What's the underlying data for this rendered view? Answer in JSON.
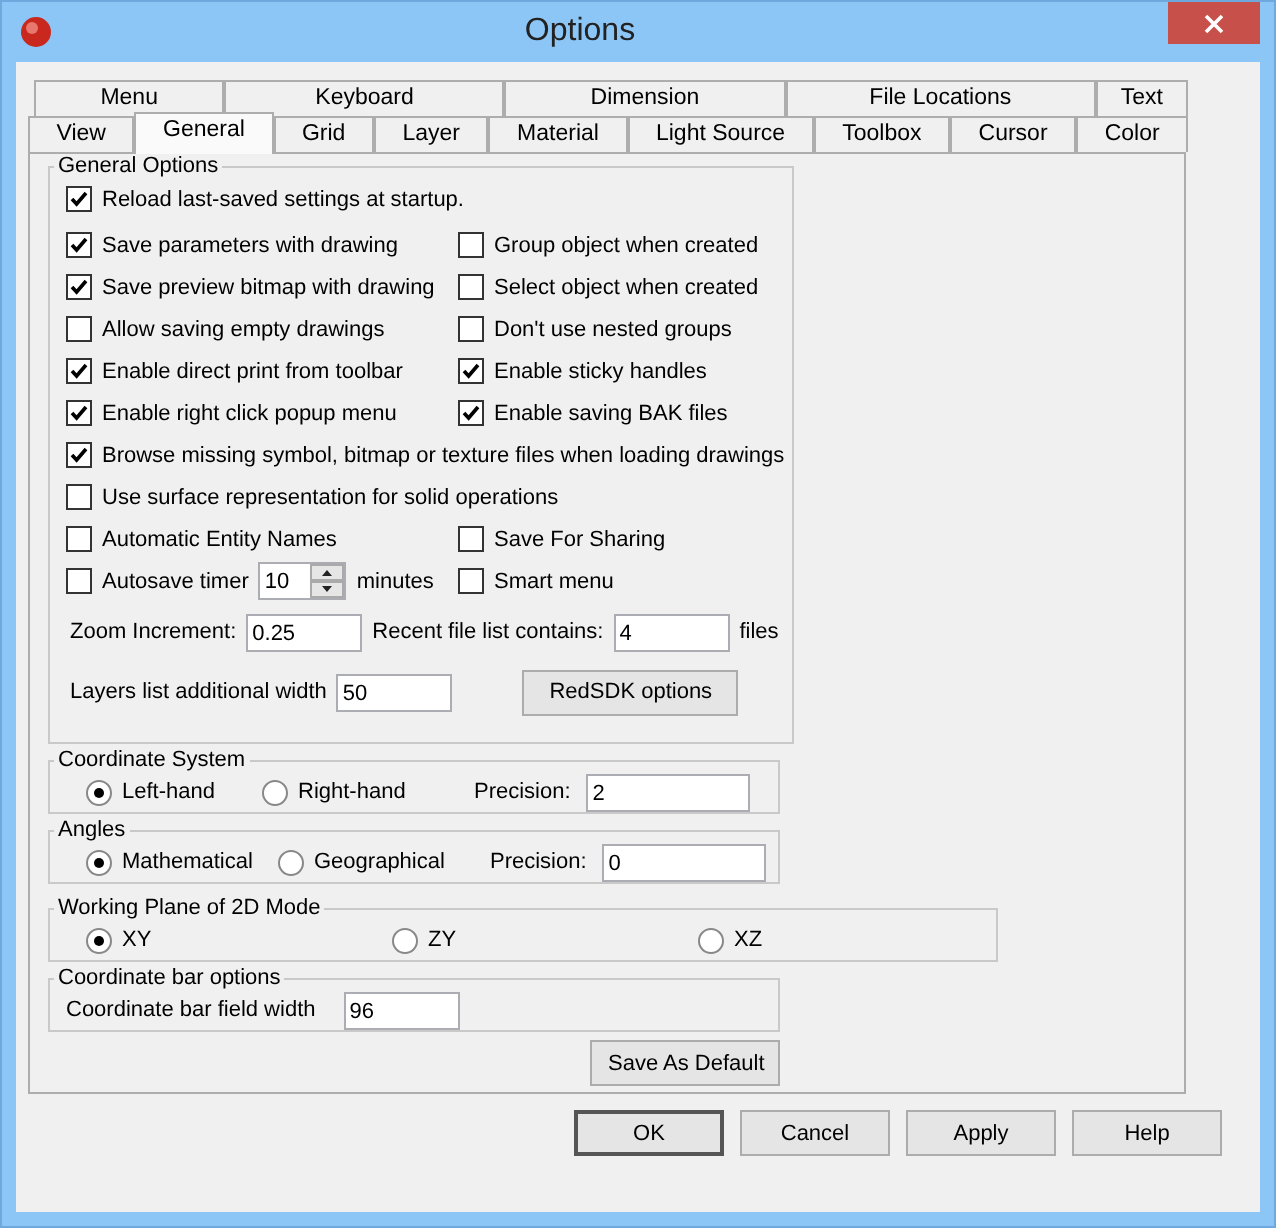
{
  "window": {
    "title": "Options"
  },
  "tab_rows": [
    [
      {
        "label": "Menu",
        "selected": false
      },
      {
        "label": "Keyboard",
        "selected": false
      },
      {
        "label": "Dimension",
        "selected": false
      },
      {
        "label": "File Locations",
        "selected": false
      },
      {
        "label": "Text",
        "selected": false
      }
    ],
    [
      {
        "label": "View",
        "selected": false
      },
      {
        "label": "General",
        "selected": true
      },
      {
        "label": "Grid",
        "selected": false
      },
      {
        "label": "Layer",
        "selected": false
      },
      {
        "label": "Material",
        "selected": false
      },
      {
        "label": "Light Source",
        "selected": false
      },
      {
        "label": "Toolbox",
        "selected": false
      },
      {
        "label": "Cursor",
        "selected": false
      },
      {
        "label": "Color",
        "selected": false
      }
    ]
  ],
  "general_options": {
    "title": "General Options",
    "rows": [
      {
        "left": [
          {
            "kind": "checkbox",
            "label": "Reload last-saved settings at startup.",
            "checked": true
          }
        ]
      },
      {
        "left": [
          {
            "kind": "checkbox",
            "label": "Save parameters with drawing",
            "checked": true
          }
        ],
        "right": [
          {
            "kind": "checkbox",
            "label": "Group object when created",
            "checked": false
          }
        ]
      },
      {
        "left": [
          {
            "kind": "checkbox",
            "label": "Save preview bitmap with drawing",
            "checked": true
          }
        ],
        "right": [
          {
            "kind": "checkbox",
            "label": "Select object when created",
            "checked": false
          }
        ]
      },
      {
        "left": [
          {
            "kind": "checkbox",
            "label": "Allow saving empty drawings",
            "checked": false
          }
        ],
        "right": [
          {
            "kind": "checkbox",
            "label": "Don't use nested groups",
            "checked": false
          }
        ]
      },
      {
        "left": [
          {
            "kind": "checkbox",
            "label": "Enable direct print from toolbar",
            "checked": true
          }
        ],
        "right": [
          {
            "kind": "checkbox",
            "label": "Enable sticky handles",
            "checked": true
          }
        ]
      },
      {
        "left": [
          {
            "kind": "checkbox",
            "label": "Enable right click popup menu",
            "checked": true
          }
        ],
        "right": [
          {
            "kind": "checkbox",
            "label": "Enable saving BAK files",
            "checked": true
          }
        ]
      },
      {
        "left": [
          {
            "kind": "checkbox",
            "label": "Browse missing symbol, bitmap or texture files when loading drawings",
            "checked": true
          }
        ]
      },
      {
        "left": [
          {
            "kind": "checkbox",
            "label": "Use surface representation for solid operations",
            "checked": false
          }
        ]
      },
      {
        "left": [
          {
            "kind": "checkbox",
            "label": "Automatic Entity Names",
            "checked": false
          }
        ],
        "right": [
          {
            "kind": "checkbox",
            "label": "Save For Sharing",
            "checked": false
          }
        ]
      },
      {
        "left": [
          {
            "kind": "checkbox",
            "label": "Autosave timer",
            "checked": false
          },
          {
            "kind": "spinner",
            "value": "10"
          },
          {
            "kind": "label",
            "text": "minutes"
          }
        ],
        "right": [
          {
            "kind": "checkbox",
            "label": "Smart menu",
            "checked": false
          }
        ]
      },
      {
        "left": [
          {
            "kind": "label",
            "text": "Zoom Increment:"
          },
          {
            "kind": "field",
            "value": "0.25"
          },
          {
            "kind": "label",
            "text": "Recent file list contains:"
          },
          {
            "kind": "field",
            "value": "4"
          },
          {
            "kind": "label",
            "text": "files"
          }
        ]
      },
      {
        "left": [
          {
            "kind": "label",
            "text": "Layers list additional width"
          },
          {
            "kind": "field",
            "value": "50"
          },
          {
            "kind": "button",
            "label": "RedSDK options"
          }
        ]
      }
    ]
  },
  "groups": [
    {
      "title": "Coordinate System",
      "items": [
        {
          "kind": "radio",
          "label": "Left-hand",
          "selected": true
        },
        {
          "kind": "radio",
          "label": "Right-hand",
          "selected": false
        },
        {
          "kind": "label",
          "text": "Precision:"
        },
        {
          "kind": "field",
          "value": "2"
        }
      ]
    },
    {
      "title": "Angles",
      "items": [
        {
          "kind": "radio",
          "label": "Mathematical",
          "selected": true
        },
        {
          "kind": "radio",
          "label": "Geographical",
          "selected": false
        },
        {
          "kind": "label",
          "text": "Precision:"
        },
        {
          "kind": "field",
          "value": "0"
        }
      ]
    },
    {
      "title": "Working Plane of 2D Mode",
      "items": [
        {
          "kind": "radio",
          "label": "XY",
          "selected": true
        },
        {
          "kind": "radio",
          "label": "ZY",
          "selected": false
        },
        {
          "kind": "radio",
          "label": "XZ",
          "selected": false
        }
      ]
    },
    {
      "title": "Coordinate bar options",
      "items": [
        {
          "kind": "label",
          "text": "Coordinate bar field width"
        },
        {
          "kind": "field",
          "value": "96"
        }
      ]
    }
  ],
  "save_default_button": "Save As Default",
  "buttons": [
    "OK",
    "Cancel",
    "Apply",
    "Help"
  ]
}
